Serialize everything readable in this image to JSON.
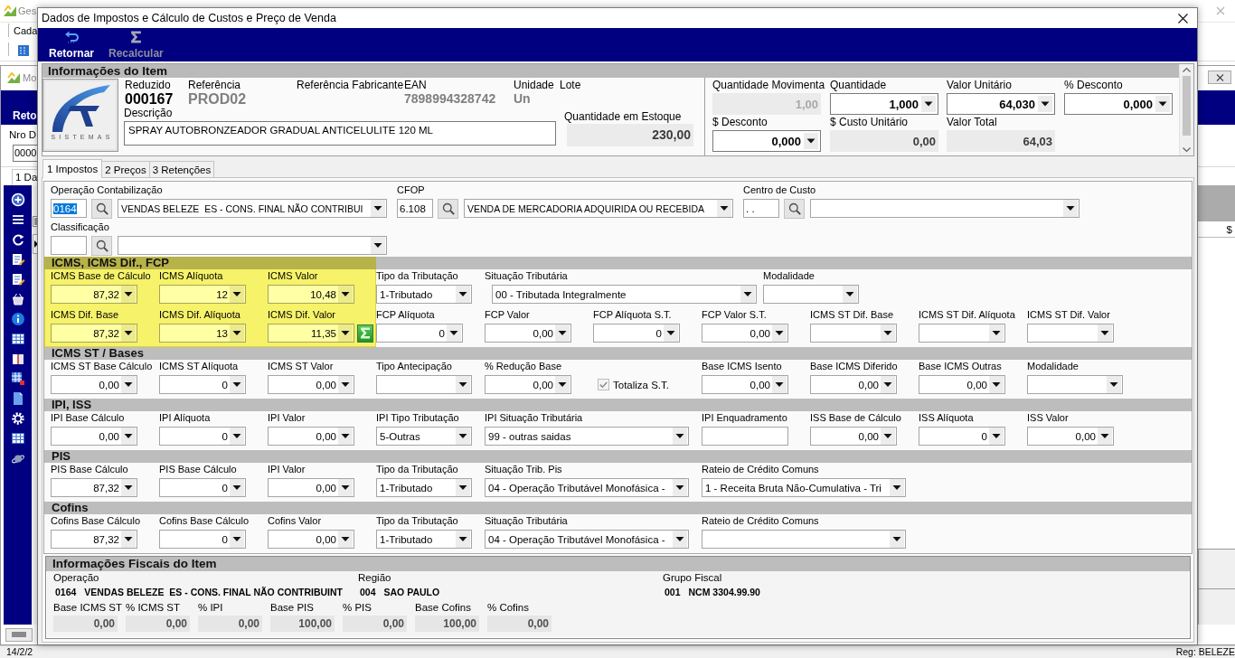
{
  "background_app": {
    "title": "Ges",
    "menu": [
      "Cada"
    ],
    "child_window": {
      "title": "Mo",
      "toolbar_button": "Reto",
      "number_label": "Nro D",
      "number_value": "0000",
      "tab": "1 Da",
      "column_header": "$"
    },
    "status_bar": {
      "date": "14/2/2",
      "register": "Reg: BELEZE"
    }
  },
  "dialog": {
    "title": "Dados de Impostos e Cálculo de Custos e Preço de Venda",
    "toolbar": [
      {
        "label": "Retornar",
        "disabled": false
      },
      {
        "label": "Recalcular",
        "disabled": true
      }
    ],
    "item_info": {
      "title": "Informações do Item",
      "logo_caption": "SISTEMAS",
      "headers": [
        {
          "label": "Reduzido",
          "value": "000167"
        },
        {
          "label": "Referência",
          "value": "PROD02"
        },
        {
          "label": "Referência Fabricante"
        },
        {
          "label": "EAN",
          "value": "7898994328742"
        },
        {
          "label": "Unidade",
          "value": "Un"
        },
        {
          "label": "Lote"
        }
      ],
      "description": {
        "label": "Descrição",
        "value": "SPRAY AUTOBRONZEADOR GRADUAL ANTICELULITE 120 ML"
      },
      "stock": {
        "label": "Quantidade em Estoque",
        "value": "230,00"
      },
      "quantities": [
        {
          "label": "Quantidade Movimenta",
          "kind": "display",
          "value": "1,00",
          "disabled": true
        },
        {
          "label": "Quantidade",
          "kind": "combo",
          "value": "1,000",
          "disabled": false
        },
        {
          "label": "Valor Unitário",
          "kind": "combo",
          "value": "64,030",
          "disabled": false
        },
        {
          "label": "% Desconto",
          "kind": "combo",
          "value": "0,000",
          "disabled": false
        },
        {
          "label": "$ Desconto",
          "kind": "combo",
          "value": "0,000",
          "disabled": false
        },
        {
          "label": "$ Custo Unitário",
          "kind": "display",
          "value": "0,00",
          "disabled": false
        },
        {
          "label": "Valor Total",
          "kind": "display",
          "value": "64,03",
          "disabled": false
        }
      ]
    },
    "tabs": [
      {
        "label": "1 Impostos",
        "selected": true
      },
      {
        "label": "2 Preços",
        "selected": false
      },
      {
        "label": "3 Retenções",
        "selected": false
      }
    ],
    "form": {
      "lookup_rows": [
        [
          {
            "label": "Operação Contabilização",
            "code": "0164",
            "code_selected": true,
            "description": "VENDAS BELEZE  ES - CONS. FINAL NÃO CONTRIBUI"
          },
          {
            "label": "CFOP",
            "code": "6.108",
            "code_selected": false,
            "description": "VENDA DE MERCADORIA ADQUIRIDA OU RECEBIDA"
          },
          {
            "label": "Centro de Custo",
            "code": ". .",
            "code_selected": false
          }
        ],
        [
          {
            "label": "Classificação"
          }
        ]
      ],
      "sections": [
        {
          "title": "ICMS, ICMS Dif., FCP",
          "groups": [
            {
              "highlighted": true,
              "rows": [
                [
                  {
                    "label": "ICMS Base de Cálculo",
                    "kind": "number",
                    "value": "87,32"
                  },
                  {
                    "label": "ICMS Alíquota",
                    "kind": "number",
                    "value": "12"
                  },
                  {
                    "label": "ICMS Valor",
                    "kind": "number",
                    "value": "10,48"
                  }
                ],
                [
                  {
                    "label": "ICMS Dif. Base",
                    "kind": "number",
                    "value": "87,32"
                  },
                  {
                    "label": "ICMS Dif. Alíquota",
                    "kind": "number",
                    "value": "13"
                  },
                  {
                    "label": "ICMS Dif. Valor",
                    "kind": "number",
                    "value": "11,35",
                    "calc_button": true
                  }
                ]
              ]
            },
            {
              "highlighted": false,
              "rows": [
                [
                  {
                    "label": "Tipo da Tributação",
                    "kind": "select",
                    "value": "1-Tributado"
                  },
                  {
                    "label": "Situação Tributária",
                    "kind": "wideselect",
                    "value": "00 - Tributada Integralmente"
                  },
                  {
                    "label": "Modalidade",
                    "kind": "select"
                  }
                ],
                [
                  {
                    "label": "FCP Alíquota",
                    "kind": "number",
                    "value": "0"
                  },
                  {
                    "label": "FCP Valor",
                    "kind": "number",
                    "value": "0,00"
                  },
                  {
                    "label": "FCP Alíquota S.T.",
                    "kind": "number",
                    "value": "0"
                  },
                  {
                    "label": "FCP Valor S.T.",
                    "kind": "number",
                    "value": "0,00"
                  },
                  {
                    "label": "ICMS ST Dif. Base",
                    "kind": "number"
                  },
                  {
                    "label": "ICMS ST Dif. Alíquota",
                    "kind": "number"
                  },
                  {
                    "label": "ICMS ST Dif. Valor",
                    "kind": "number"
                  }
                ]
              ]
            }
          ]
        },
        {
          "title": "ICMS ST / Bases",
          "groups": [
            {
              "highlighted": false,
              "rows": [
                [
                  {
                    "label": "ICMS ST Base Cálculo",
                    "kind": "number",
                    "value": "0,00"
                  },
                  {
                    "label": "ICMS ST Alíquota",
                    "kind": "number",
                    "value": "0"
                  },
                  {
                    "label": "ICMS ST Valor",
                    "kind": "number",
                    "value": "0,00"
                  },
                  {
                    "label": "Tipo Antecipação",
                    "kind": "select"
                  },
                  {
                    "label": "% Redução Base",
                    "kind": "number",
                    "value": "0,00"
                  },
                  {
                    "label": "Totaliza S.T.",
                    "kind": "checkbox",
                    "checked": true,
                    "disabled": true
                  },
                  {
                    "label": "Base ICMS Isento",
                    "kind": "number",
                    "value": "0,00"
                  },
                  {
                    "label": "Base ICMS Diferido",
                    "kind": "number",
                    "value": "0,00"
                  },
                  {
                    "label": "Base ICMS Outras",
                    "kind": "number",
                    "value": "0,00"
                  },
                  {
                    "label": "Modalidade",
                    "kind": "select"
                  }
                ]
              ]
            }
          ]
        },
        {
          "title": "IPI, ISS",
          "groups": [
            {
              "highlighted": false,
              "rows": [
                [
                  {
                    "label": "IPI Base Cálculo",
                    "kind": "number",
                    "value": "0,00"
                  },
                  {
                    "label": "IPI Alíquota",
                    "kind": "number",
                    "value": "0"
                  },
                  {
                    "label": "IPI Valor",
                    "kind": "number",
                    "value": "0,00"
                  },
                  {
                    "label": "IPI Tipo Tributação",
                    "kind": "select",
                    "value": "5-Outras"
                  },
                  {
                    "label": "IPI Situação Tributária",
                    "kind": "longselect",
                    "value": "99 - outras saidas"
                  },
                  {
                    "label": "IPI Enquadramento",
                    "kind": "text"
                  },
                  {
                    "label": "ISS Base de Cálculo",
                    "kind": "number",
                    "value": "0,00"
                  },
                  {
                    "label": "ISS Alíquota",
                    "kind": "number",
                    "value": "0"
                  },
                  {
                    "label": "ISS Valor",
                    "kind": "number",
                    "value": "0,00"
                  }
                ]
              ]
            }
          ]
        },
        {
          "title": "PIS",
          "groups": [
            {
              "highlighted": false,
              "rows": [
                [
                  {
                    "label": "PIS Base Cálculo",
                    "kind": "number",
                    "value": "87,32"
                  },
                  {
                    "label": "PIS Base Cálculo",
                    "kind": "number",
                    "value": "0"
                  },
                  {
                    "label": "IPI Valor",
                    "kind": "number",
                    "value": "0,00"
                  },
                  {
                    "label": "Tipo da Tributação",
                    "kind": "select",
                    "value": "1-Tributado"
                  },
                  {
                    "label": "Situação Trib. Pis",
                    "kind": "longselect",
                    "value": "04 - Operação Tributável Monofásica -"
                  },
                  {
                    "label": "Rateio de Crédito Comuns",
                    "kind": "longselect",
                    "value": "1 - Receita Bruta Não-Cumulativa - Tri"
                  }
                ]
              ]
            }
          ]
        },
        {
          "title": "Cofins",
          "groups": [
            {
              "highlighted": false,
              "rows": [
                [
                  {
                    "label": "Cofins Base Cálculo",
                    "kind": "number",
                    "value": "87,32"
                  },
                  {
                    "label": "Cofins Base Cálculo",
                    "kind": "number",
                    "value": "0"
                  },
                  {
                    "label": "Cofins Valor",
                    "kind": "number",
                    "value": "0,00"
                  },
                  {
                    "label": "Tipo da Tributação",
                    "kind": "select",
                    "value": "1-Tributado"
                  },
                  {
                    "label": "Situação Tributária",
                    "kind": "longselect",
                    "value": "04 - Operação Tributável Monofásica -"
                  },
                  {
                    "label": "Rateio de Crédito Comuns",
                    "kind": "longselect"
                  }
                ]
              ]
            }
          ]
        }
      ]
    },
    "fiscal_info": {
      "title": "Informações Fiscais do Item",
      "entries": [
        {
          "label": "Operação",
          "code": "0164",
          "name": "VENDAS BELEZE  ES - CONS. FINAL NÃO CONTRIBUINT"
        },
        {
          "label": "Região",
          "code": "004",
          "name": "SAO PAULO"
        },
        {
          "label": "Grupo Fiscal",
          "code": "001",
          "name": "NCM 3304.99.90"
        }
      ],
      "totals": [
        {
          "label": "Base ICMS ST",
          "value": "0,00"
        },
        {
          "label": "% ICMS ST",
          "value": "0,00"
        },
        {
          "label": "% IPI",
          "value": "0,00"
        },
        {
          "label": "Base PIS",
          "value": "100,00"
        },
        {
          "label": "% PIS",
          "value": "0,00"
        },
        {
          "label": "Base Cofins",
          "value": "100,00"
        },
        {
          "label": "% Cofins",
          "value": "0,00"
        }
      ]
    }
  }
}
